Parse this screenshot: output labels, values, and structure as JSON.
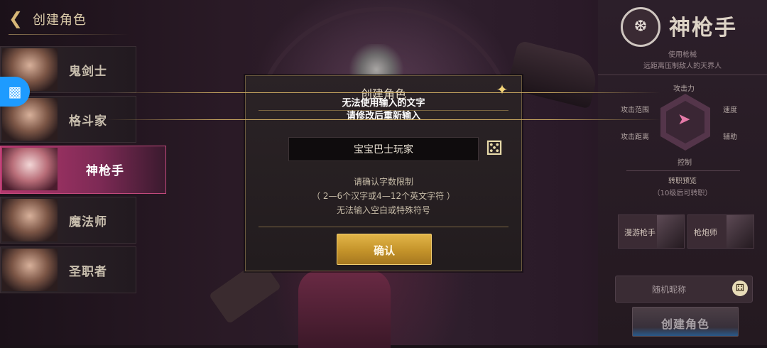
{
  "header": {
    "back_icon": "arrow-left-icon",
    "title": "创建角色"
  },
  "classes": [
    {
      "name": "鬼剑士",
      "active": false
    },
    {
      "name": "格斗家",
      "active": false
    },
    {
      "name": "神枪手",
      "active": true
    },
    {
      "name": "魔法师",
      "active": false
    },
    {
      "name": "圣职者",
      "active": false
    }
  ],
  "floating": {
    "gamepad_icon": "gamepad-icon"
  },
  "panel": {
    "emblem_icon": "class-emblem-icon",
    "class_title": "神枪手",
    "desc_line1": "使用枪械",
    "desc_line2": "远距离压制敌人的天界人",
    "stats": {
      "attack_power": "攻击力",
      "attack_range": "攻击范围",
      "speed": "速度",
      "attack_distance": "攻击距离",
      "support": "辅助",
      "control": "控制"
    },
    "advancement_title": "转职预览",
    "advancement_sub": "（10级后可转职）",
    "subclasses": [
      "漫游枪手",
      "枪炮师"
    ],
    "random_name_label": "随机昵称",
    "create_label": "创建角色"
  },
  "dialog": {
    "title": "创建角色",
    "close_icon": "close-sparkle-icon",
    "name_value": "宝宝巴士玩家",
    "dice_icon": "dice-icon",
    "rule_line1": "请确认字数限制",
    "rule_line2": "（ 2—6个汉字或4—12个英文字符 ）",
    "rule_line3": "无法输入空白或特殊符号",
    "confirm_label": "确认"
  },
  "toast": {
    "line1": "无法使用输入的文字",
    "line2": "请修改后重新输入"
  }
}
